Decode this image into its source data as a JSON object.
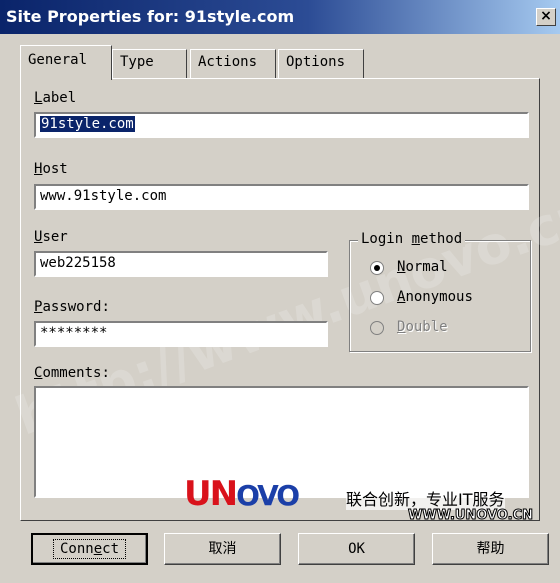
{
  "window": {
    "title": "Site Properties for: 91style.com",
    "close_glyph": "×"
  },
  "tabs": [
    {
      "label": "General",
      "active": true
    },
    {
      "label": "Type",
      "active": false
    },
    {
      "label": "Actions",
      "active": false
    },
    {
      "label": "Options",
      "active": false
    }
  ],
  "general": {
    "label_caption_mnemonic": "L",
    "label_caption_rest": "abel",
    "label_value": "91style.com",
    "host_caption_mnemonic": "H",
    "host_caption_rest": "ost",
    "host_value": "www.91style.com",
    "user_caption_mnemonic": "U",
    "user_caption_rest": "ser",
    "user_value": "web225158",
    "password_caption_mnemonic": "P",
    "password_caption_rest": "assword:",
    "password_value": "********",
    "comments_caption_mnemonic": "C",
    "comments_caption_rest": "omments:",
    "comments_value": ""
  },
  "login_method": {
    "legend_pre": "Login ",
    "legend_mnemonic": "m",
    "legend_post": "ethod",
    "options": [
      {
        "mnemonic": "N",
        "rest": "ormal",
        "checked": true,
        "disabled": false
      },
      {
        "mnemonic": "A",
        "rest": "nonymous",
        "checked": false,
        "disabled": false
      },
      {
        "mnemonic": "D",
        "rest": "ouble",
        "checked": false,
        "disabled": true
      }
    ]
  },
  "overlay": {
    "watermark": "http://www.unovo.cn",
    "logo_un": "UN",
    "logo_ovo": "OVO",
    "slogan": "联合创新，专业IT服务",
    "site_url": "WWW.UNOVO.CN"
  },
  "buttons": {
    "connect_pre": "Conn",
    "connect_mnemonic": "e",
    "connect_post": "ct",
    "cancel": "取消",
    "ok": "OK",
    "help": "帮助"
  }
}
